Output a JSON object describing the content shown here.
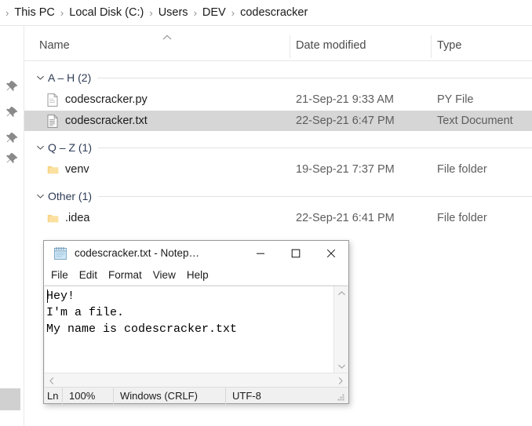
{
  "breadcrumb": {
    "separator": "›",
    "items": [
      {
        "label": "This PC"
      },
      {
        "label": "Local Disk (C:)"
      },
      {
        "label": "Users"
      },
      {
        "label": "DEV"
      },
      {
        "label": "codescracker"
      }
    ]
  },
  "nav_rail": {
    "pins": [
      {
        "icon": "pin-icon"
      },
      {
        "icon": "pin-icon"
      },
      {
        "icon": "pin-icon"
      },
      {
        "icon": "pin-icon"
      }
    ]
  },
  "columns": {
    "name": "Name",
    "date_modified": "Date modified",
    "type": "Type",
    "sort_indicator": "sort-ascending-icon"
  },
  "groups": [
    {
      "label": "A – H (2)",
      "chevron": "chevron-down-icon",
      "rows": [
        {
          "name": "codescracker.py",
          "date": "21-Sep-21 9:33 AM",
          "type": "PY File",
          "icon": "file-icon",
          "selected": false
        },
        {
          "name": "codescracker.txt",
          "date": "22-Sep-21 6:47 PM",
          "type": "Text Document",
          "icon": "text-file-icon",
          "selected": true
        }
      ]
    },
    {
      "label": "Q – Z (1)",
      "chevron": "chevron-down-icon",
      "rows": [
        {
          "name": "venv",
          "date": "19-Sep-21 7:37 PM",
          "type": "File folder",
          "icon": "folder-icon",
          "selected": false
        }
      ]
    },
    {
      "label": "Other (1)",
      "chevron": "chevron-down-icon",
      "rows": [
        {
          "name": ".idea",
          "date": "22-Sep-21 6:41 PM",
          "type": "File folder",
          "icon": "folder-icon",
          "selected": false
        }
      ]
    }
  ],
  "notepad": {
    "title": "codescracker.txt - Notep…",
    "icon": "notepad-icon",
    "window_buttons": {
      "minimize": "–",
      "maximize": "□",
      "close": "✕"
    },
    "menu": [
      {
        "label": "File"
      },
      {
        "label": "Edit"
      },
      {
        "label": "Format"
      },
      {
        "label": "View"
      },
      {
        "label": "Help"
      }
    ],
    "content": "Hey!\nI'm a file.\nMy name is codescracker.txt",
    "scrollbars": {
      "up": "chevron-up-icon",
      "down": "chevron-down-icon",
      "left": "chevron-left-icon",
      "right": "chevron-right-icon"
    },
    "status": {
      "line_col": "Ln",
      "zoom": "100%",
      "line_ending": "Windows (CRLF)",
      "encoding": "UTF-8"
    }
  },
  "colors": {
    "selection": "#d6d6d6",
    "folder": "#f9d57e",
    "group_label": "#2e3b55"
  }
}
